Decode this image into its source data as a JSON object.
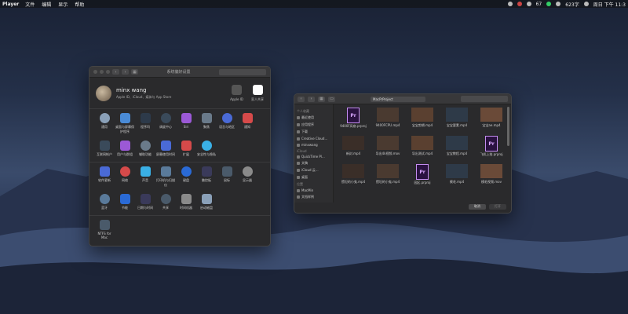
{
  "menubar": {
    "app": "Player",
    "menus": [
      "文件",
      "编辑",
      "显示",
      "帮助"
    ],
    "status": [
      "67",
      "623字",
      "周日 下午 11:3"
    ]
  },
  "prefs": {
    "title": "系统偏好设置",
    "account": {
      "name": "minx wang",
      "subtitle": "Apple ID、iCloud、媒体与 App Store",
      "apple_id": "Apple ID",
      "family": "家人共享"
    },
    "rows": [
      [
        "通用",
        "桌面与屏幕保护程序",
        "程序坞",
        "调度中心",
        "Siri",
        "聚焦",
        "语言与地区",
        "通知"
      ],
      [
        "互联网帐户",
        "用户与群组",
        "辅助功能",
        "屏幕使用时间",
        "扩展",
        "安全性与隐私"
      ],
      [
        "软件更新",
        "网络",
        "声音",
        "打印机与扫描仪",
        "键盘",
        "触控板",
        "鼠标",
        "显示器"
      ],
      [
        "蓝牙",
        "节能",
        "日期与时间",
        "共享",
        "时间机器",
        "启动磁盘"
      ],
      [
        "NTFS for Mac"
      ]
    ]
  },
  "finder": {
    "folder": "MacPrProject",
    "sidebar": {
      "h1": "个人收藏",
      "fav": [
        "最近使用",
        "应用程序",
        "下载",
        "Creative Cloud...",
        "minxwang"
      ],
      "h2": "iCloud",
      "icloud": [
        "QuickTime Pl...",
        "文稿",
        "iCloud 云...",
        "桌面"
      ],
      "h3": "位置",
      "loc": [
        "MacMin",
        "文档样例"
      ]
    },
    "files": [
      "9400F风扇.prproj",
      "9400FCPU.mp4",
      "宝宝剪辑.mp4",
      "宝宝要素.mp4",
      "宝宝ae.mp4",
      "新封.mp4",
      "导出4k视频.mov",
      "导出测试.mp4",
      "宝宝教程.mp4",
      "飞机上拍.prproj",
      "惯坦的小鬼.mp4",
      "惯坦的小鬼.mp4",
      "园区.prproj",
      "模毛.mp4",
      "模毛视频.mov"
    ],
    "buttons": {
      "cancel": "取消",
      "open": "打开"
    }
  }
}
